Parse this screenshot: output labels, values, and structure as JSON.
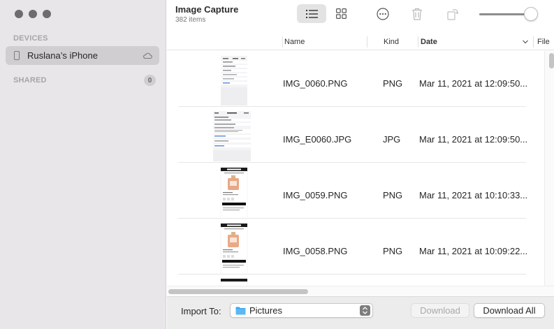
{
  "sidebar": {
    "devices_label": "DEVICES",
    "device_name": "Ruslana’s iPhone",
    "shared_label": "SHARED",
    "shared_count": "0"
  },
  "toolbar": {
    "title": "Image Capture",
    "item_count": "382 items",
    "icons": [
      "list-view-icon",
      "grid-view-icon",
      "more-icon",
      "trash-icon",
      "rotate-icon"
    ],
    "thumbnail_size_fraction": 0.92
  },
  "columns": {
    "name": "Name",
    "kind": "Kind",
    "date": "Date",
    "file": "File"
  },
  "rows": [
    {
      "name": "IMG_0060.PNG",
      "kind": "PNG",
      "date": "Mar 11, 2021 at 12:09:50..."
    },
    {
      "name": "IMG_E0060.JPG",
      "kind": "JPG",
      "date": "Mar 11, 2021 at 12:09:50..."
    },
    {
      "name": "IMG_0059.PNG",
      "kind": "PNG",
      "date": "Mar 11, 2021 at 10:10:33..."
    },
    {
      "name": "IMG_0058.PNG",
      "kind": "PNG",
      "date": "Mar 11, 2021 at 10:09:22..."
    }
  ],
  "bottom": {
    "import_label": "Import To:",
    "destination": "Pictures",
    "download_label": "Download",
    "download_all_label": "Download All"
  },
  "colors": {
    "sidebar_bg": "#e8e6e9",
    "selection": "#d0ced1",
    "folder_blue": "#3aa6f0"
  }
}
